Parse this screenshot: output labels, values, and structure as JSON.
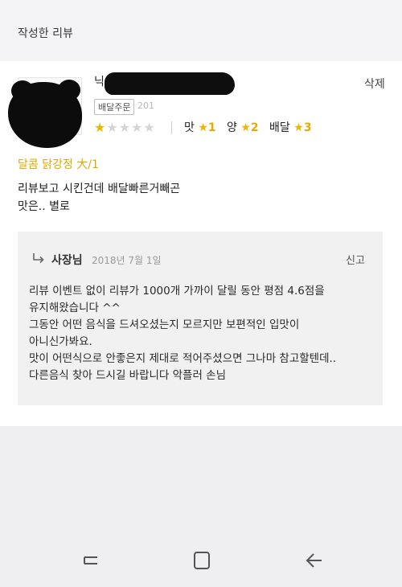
{
  "header": {
    "title": "작성한 리뷰"
  },
  "review": {
    "reviewer_name_visible": "닉",
    "order_badge": "배달주문",
    "date_partial": "201",
    "delete_label": "삭제",
    "rating_stars": 1,
    "rating_max": 5,
    "sub_ratings": [
      {
        "label": "맛",
        "score": "1"
      },
      {
        "label": "양",
        "score": "2"
      },
      {
        "label": "배달",
        "score": "3"
      }
    ],
    "menu_name": "달콤 닭강정 大/1",
    "text_lines": [
      "리뷰보고 시킨건데 배달빠른거빼곤",
      "맛은.. 별로"
    ]
  },
  "reply": {
    "author": "사장님",
    "date": "2018년 7월 1일",
    "report_label": "신고",
    "text_lines": [
      "리뷰 이벤트 없이 리뷰가 1000개 가까이 달릴 동안 평점 4.6점을",
      "유지해왔습니다 ^^",
      "그동안 어떤 음식을 드셔오셨는지 모르지만 보편적인 입맛이",
      "아니신가봐요.",
      "맛이 어떤식으로 안좋은지 제대로 적어주셨으면 그나마 참고할텐데..",
      "다른음식 찾아 드시길 바랍니다 악플러 손님"
    ]
  },
  "colors": {
    "accent_star": "#f0b400",
    "menu_name": "#e0a800",
    "background": "#efeef0"
  },
  "navbar": {
    "icons": [
      "recent-apps-icon",
      "home-icon",
      "back-icon"
    ]
  }
}
